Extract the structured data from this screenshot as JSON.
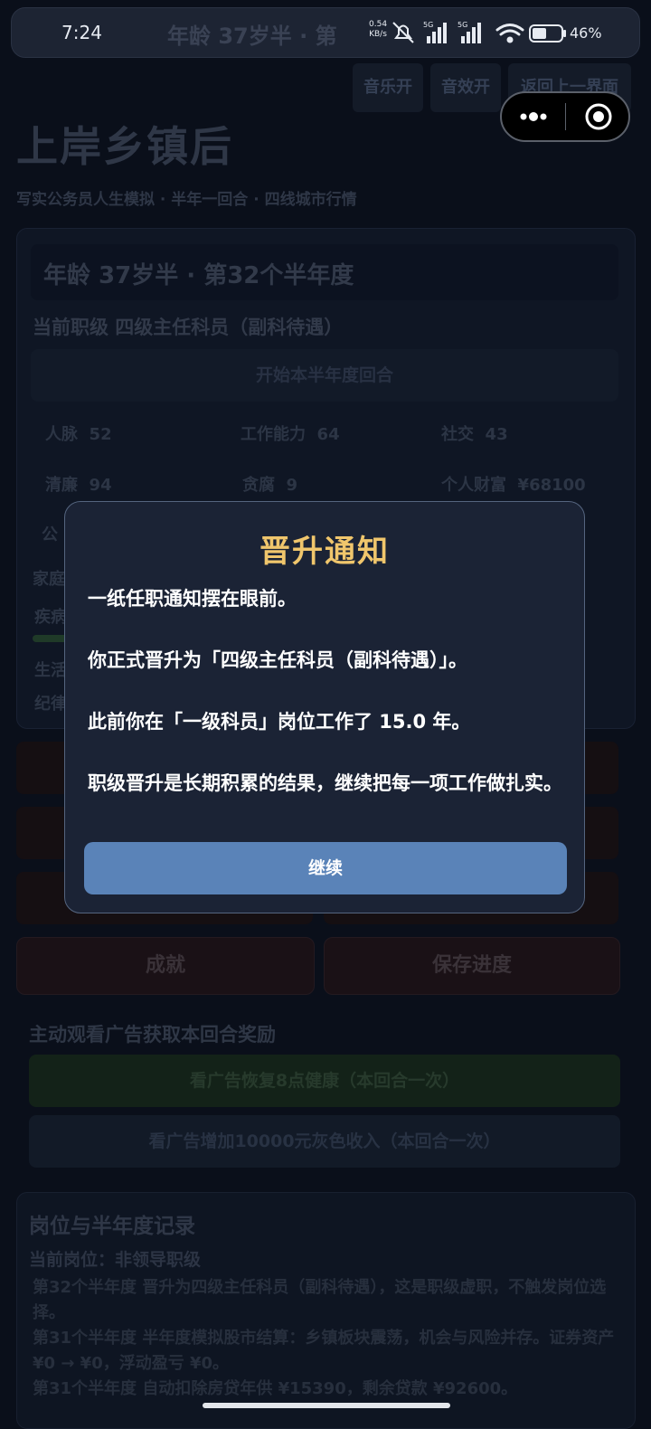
{
  "status_bar": {
    "time": "7:24",
    "ghost_text": "年龄  37岁半   ·   第",
    "net_speed_value": "0.54",
    "net_speed_unit": "KB/s",
    "net_label_1": "5G",
    "net_label_2": "5G",
    "battery": "46"
  },
  "header": {
    "music_btn": "音乐开",
    "sfx_btn": "音效开",
    "back_btn": "返回上一界面",
    "title": "上岸乡镇后",
    "subtitle": "写实公务员人生模拟  ·  半年一回合  ·  四线城市行情"
  },
  "status_card": {
    "age_line": "年龄  37岁半   ·   第32个半年度",
    "rank_line": "当前职级  四级主任科员（副科待遇）",
    "start_button": "开始本半年度回合",
    "stats": [
      {
        "label": "人脉",
        "value": "52"
      },
      {
        "label": "工作能力",
        "value": "64"
      },
      {
        "label": "社交",
        "value": "43"
      },
      {
        "label": "清廉",
        "value": "94"
      },
      {
        "label": "贪腐",
        "value": "9"
      },
      {
        "label": "个人财富",
        "value": "¥68100"
      }
    ],
    "partial_1": "公",
    "partial_2": "家庭",
    "partial_3": "疾病",
    "partial_4": "生活",
    "partial_5": "纪律"
  },
  "bottom_buttons": {
    "achievements": "成就",
    "save": "保存进度"
  },
  "ads": {
    "title": "主动观看广告获取本回合奖励",
    "health_btn": "看广告恢复8点健康（本回合一次）",
    "income_btn": "看广告增加10000元灰色收入（本回合一次）"
  },
  "log": {
    "title": "岗位与半年度记录",
    "current_post": "当前岗位：非领导职级",
    "lines": [
      "第32个半年度  晋升为四级主任科员（副科待遇），这是职级虚职，不触发岗位选择。",
      "第31个半年度  半年度模拟股市结算：乡镇板块震荡，机会与风险并存。证券资产 ¥0 → ¥0，浮动盈亏 ¥0。",
      "第31个半年度  自动扣除房贷年供 ¥15390，剩余贷款 ¥92600。"
    ]
  },
  "modal": {
    "title": "晋升通知",
    "p1": "一纸任职通知摆在眼前。",
    "p2": "你正式晋升为「四级主任科员（副科待遇）」。",
    "p3": "此前你在「一级科员」岗位工作了 15.0 年。",
    "p4": "职级晋升是长期积累的结果，继续把每一项工作做扎实。",
    "continue": "继续"
  }
}
